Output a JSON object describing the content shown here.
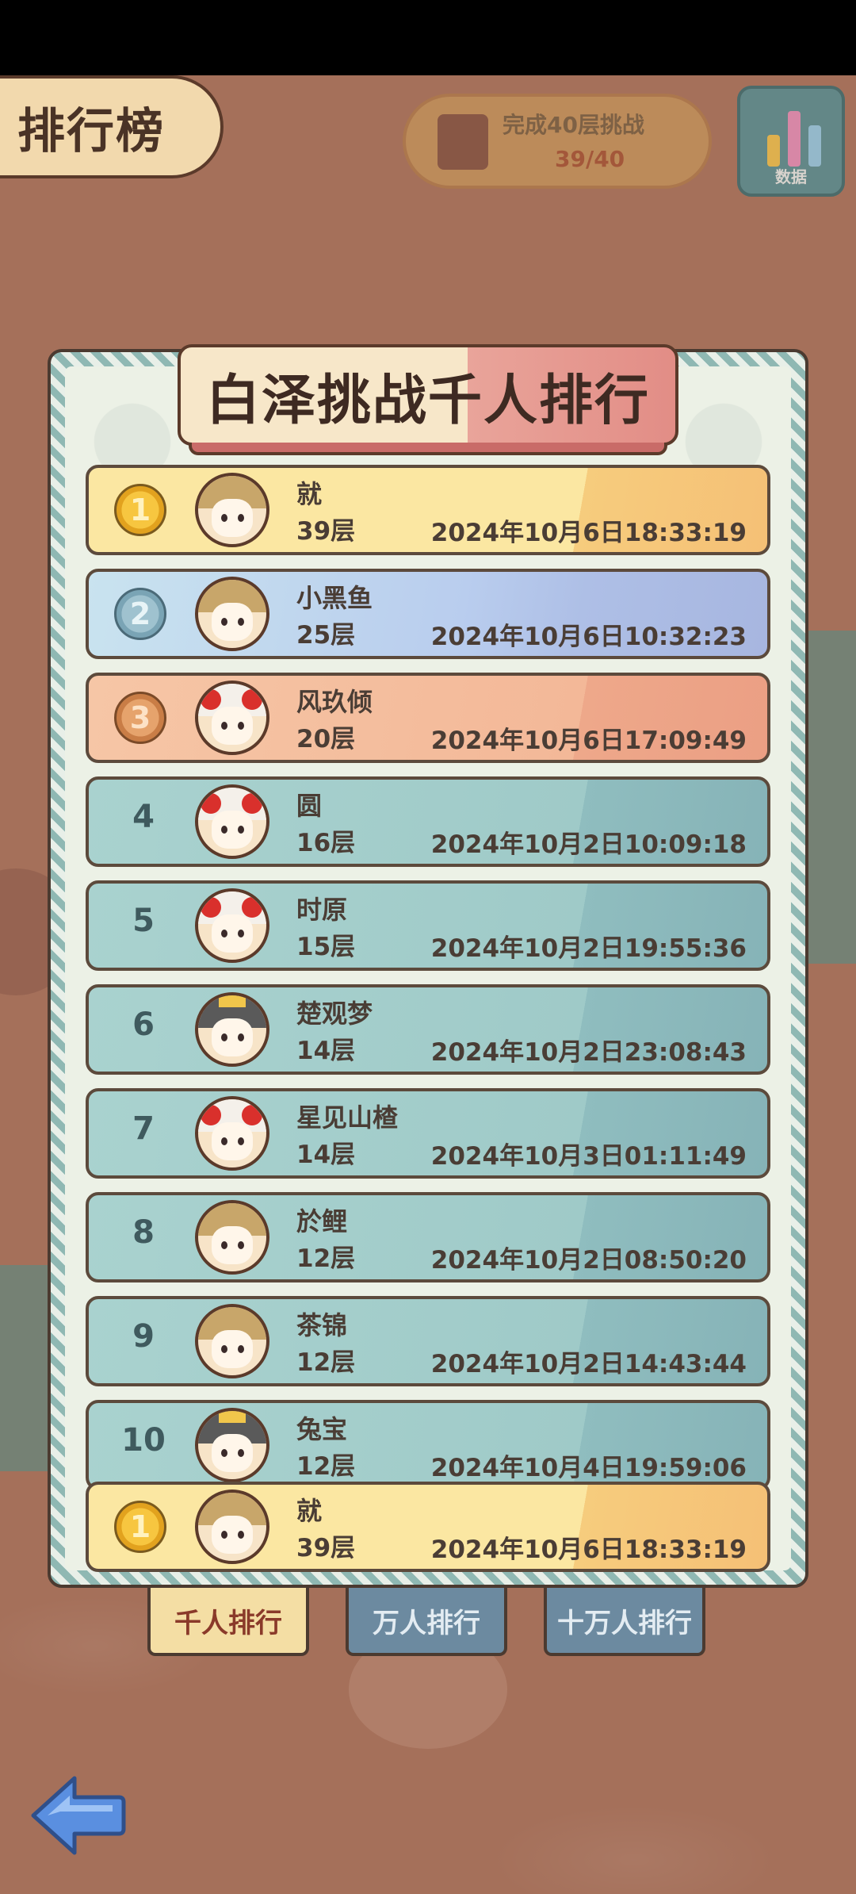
{
  "header": {
    "title": "排行榜",
    "reward_text": "完成40层挑战",
    "reward_count": "39/40",
    "stats_label": "数据"
  },
  "panel": {
    "title": "白泽挑战千人排行"
  },
  "rows": [
    {
      "rank": "1",
      "medal": "gold",
      "name": "就",
      "floor": "39层",
      "time": "2024年10月6日18:33:19",
      "avatar": "blond"
    },
    {
      "rank": "2",
      "medal": "silver",
      "name": "小黑鱼",
      "floor": "25层",
      "time": "2024年10月6日10:32:23",
      "avatar": "blond"
    },
    {
      "rank": "3",
      "medal": "bronze",
      "name": "风玖倾",
      "floor": "20层",
      "time": "2024年10月6日17:09:49",
      "avatar": "red"
    },
    {
      "rank": "4",
      "medal": "",
      "name": "圆",
      "floor": "16层",
      "time": "2024年10月2日10:09:18",
      "avatar": "red"
    },
    {
      "rank": "5",
      "medal": "",
      "name": "时原",
      "floor": "15层",
      "time": "2024年10月2日19:55:36",
      "avatar": "red"
    },
    {
      "rank": "6",
      "medal": "",
      "name": "楚观梦",
      "floor": "14层",
      "time": "2024年10月2日23:08:43",
      "avatar": "cat"
    },
    {
      "rank": "7",
      "medal": "",
      "name": "星见山楂",
      "floor": "14层",
      "time": "2024年10月3日01:11:49",
      "avatar": "red"
    },
    {
      "rank": "8",
      "medal": "",
      "name": "於鲤",
      "floor": "12层",
      "time": "2024年10月2日08:50:20",
      "avatar": "blond"
    },
    {
      "rank": "9",
      "medal": "",
      "name": "茶锦",
      "floor": "12层",
      "time": "2024年10月2日14:43:44",
      "avatar": "blond"
    },
    {
      "rank": "10",
      "medal": "",
      "name": "兔宝",
      "floor": "12层",
      "time": "2024年10月4日19:59:06",
      "avatar": "cat"
    }
  ],
  "self_row": {
    "rank": "1",
    "medal": "gold",
    "name": "就",
    "floor": "39层",
    "time": "2024年10月6日18:33:19",
    "avatar": "blond"
  },
  "tabs": [
    {
      "label": "千人排行",
      "active": true
    },
    {
      "label": "万人排行",
      "active": false
    },
    {
      "label": "十万人排行",
      "active": false
    }
  ],
  "icons": {
    "back": "back-arrow-icon",
    "stats": "bar-chart-icon",
    "reward": "gift-box-icon",
    "medal": "medal-icon",
    "avatar": "avatar-icon"
  },
  "colors": {
    "background": "#a5705a",
    "gold_row": "#fbe7a2",
    "silver_row": "#b9cdee",
    "bronze_row": "#f3b898",
    "normal_row": "#9fcac8",
    "active_tab": "#f4dea4",
    "inactive_tab": "#6c8aa0",
    "back_button": "#5a8fe0"
  }
}
